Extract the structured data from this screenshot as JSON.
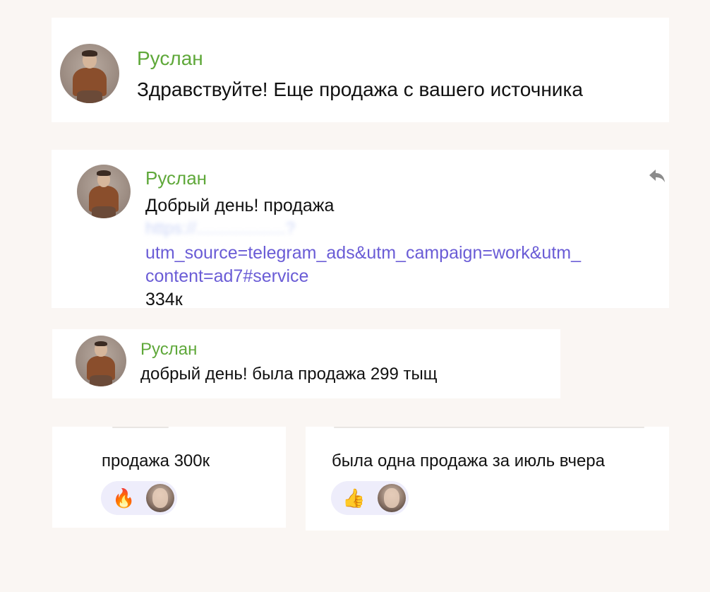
{
  "messages": [
    {
      "author": "Руслан",
      "text": "Здравствуйте! Еще продажа с вашего источника"
    },
    {
      "author": "Руслан",
      "text": "Добрый день! продажа",
      "link_hidden": "https://...................?",
      "link_line1": "utm_source=telegram_ads&utm_campaign=work&utm_",
      "link_line2": "content=ad7#service",
      "amount": "334к",
      "reply_icon": "reply-arrow-icon"
    },
    {
      "author": "Руслан",
      "text": "добрый день! была продажа 299 тыщ"
    }
  ],
  "reaction_cards": [
    {
      "text": "продажа 300к",
      "reaction_emoji": "🔥",
      "reaction_icon": "fire-emoji-icon"
    },
    {
      "text": "была одна продажа за июль вчера",
      "reaction_emoji": "👍",
      "reaction_icon": "thumbs-up-emoji-icon"
    }
  ],
  "colors": {
    "background": "#faf6f3",
    "card": "#ffffff",
    "author_name": "#5fa83a",
    "link": "#6a5cd6",
    "reaction_bg": "#eeedfb"
  }
}
